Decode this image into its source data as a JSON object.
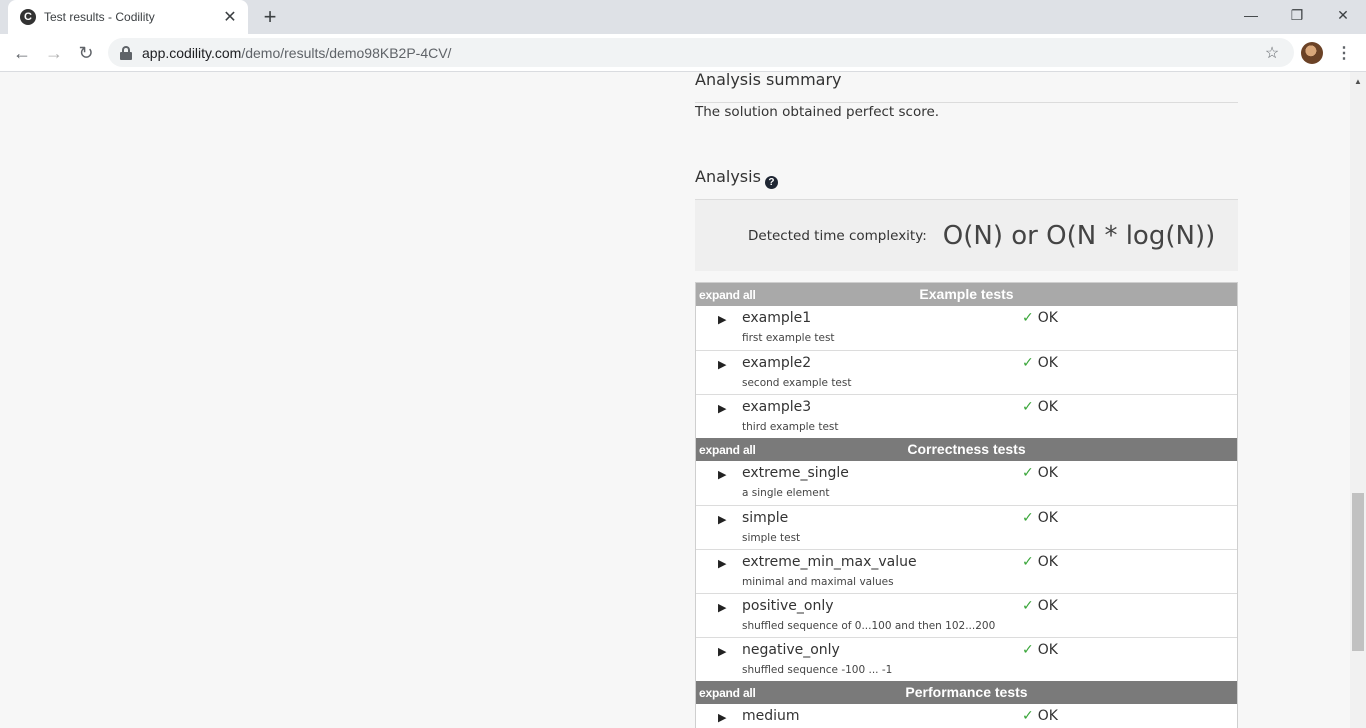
{
  "browser": {
    "tab_title": "Test results - Codility",
    "favicon_letter": "C",
    "url_domain": "app.codility.com",
    "url_path": "/demo/results/demo98KB2P-4CV/"
  },
  "analysis_summary": {
    "heading": "Analysis summary",
    "text": "The solution obtained perfect score."
  },
  "analysis": {
    "heading": "Analysis",
    "help_glyph": "?",
    "complexity_label": "Detected time complexity:",
    "complexity_value": "O(N) or O(N * log(N))"
  },
  "test_groups": [
    {
      "expand_label": "expand all",
      "title": "Example tests",
      "tests": [
        {
          "name": "example1",
          "desc": "first example test",
          "status": "OK"
        },
        {
          "name": "example2",
          "desc": "second example test",
          "status": "OK"
        },
        {
          "name": "example3",
          "desc": "third example test",
          "status": "OK"
        }
      ]
    },
    {
      "expand_label": "expand all",
      "title": "Correctness tests",
      "tests": [
        {
          "name": "extreme_single",
          "desc": "a single element",
          "status": "OK"
        },
        {
          "name": "simple",
          "desc": "simple test",
          "status": "OK"
        },
        {
          "name": "extreme_min_max_value",
          "desc": "minimal and maximal values",
          "status": "OK"
        },
        {
          "name": "positive_only",
          "desc": "shuffled sequence of 0...100 and then 102...200",
          "status": "OK"
        },
        {
          "name": "negative_only",
          "desc": "shuffled sequence -100 ... -1",
          "status": "OK"
        }
      ]
    },
    {
      "expand_label": "expand all",
      "title": "Performance tests",
      "tests": [
        {
          "name": "medium",
          "desc": "",
          "status": "OK"
        }
      ]
    }
  ],
  "icons": {
    "check": "✓",
    "expand_arrow": "▶"
  }
}
